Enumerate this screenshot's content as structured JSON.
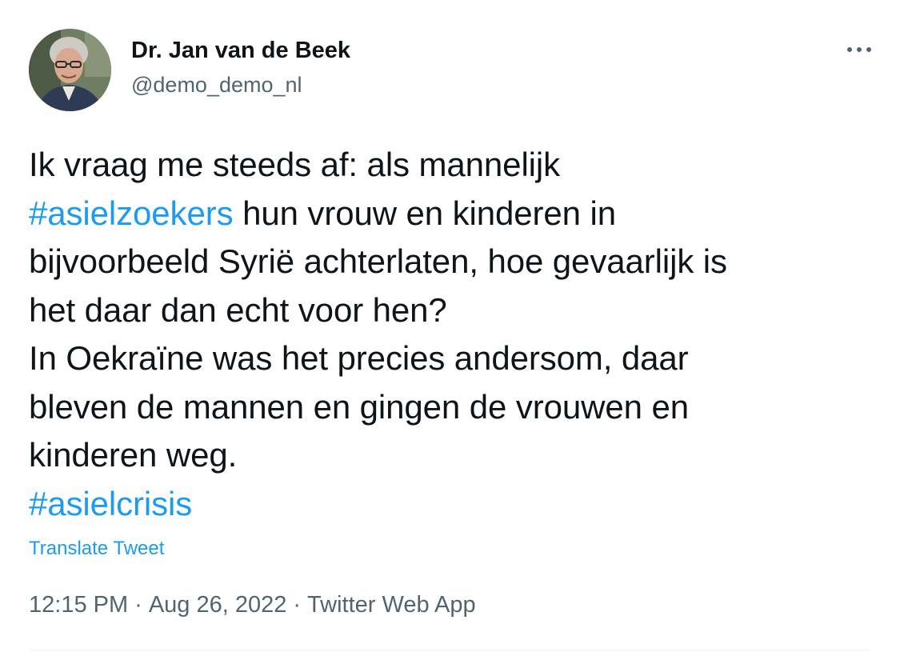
{
  "author": {
    "display_name": "Dr. Jan van de Beek",
    "handle": "@demo_demo_nl"
  },
  "tweet": {
    "lines": [
      [
        {
          "text": "Ik vraag me steeds af: als mannelijk",
          "hashtag": false
        }
      ],
      [
        {
          "text": "#asielzoekers",
          "hashtag": true
        },
        {
          "text": " hun vrouw en kinderen in",
          "hashtag": false
        }
      ],
      [
        {
          "text": "bijvoorbeeld Syrië achterlaten, hoe gevaarlijk is",
          "hashtag": false
        }
      ],
      [
        {
          "text": "het daar dan echt voor hen?",
          "hashtag": false
        }
      ],
      [
        {
          "text": "In Oekraïne was het precies andersom, daar",
          "hashtag": false
        }
      ],
      [
        {
          "text": "bleven de mannen en gingen de vrouwen en",
          "hashtag": false
        }
      ],
      [
        {
          "text": "kinderen weg.",
          "hashtag": false
        }
      ],
      [
        {
          "text": "#asielcrisis",
          "hashtag": true
        }
      ]
    ],
    "translate_label": "Translate Tweet",
    "time": "12:15 PM",
    "date": "Aug 26, 2022",
    "separator": "·",
    "source": "Twitter Web App"
  },
  "icons": {
    "more": "more-options-icon",
    "avatar": "profile-photo"
  },
  "colors": {
    "text": "#0f1419",
    "secondary": "#536471",
    "link": "#1d9bf0",
    "divider": "#eff3f4"
  }
}
